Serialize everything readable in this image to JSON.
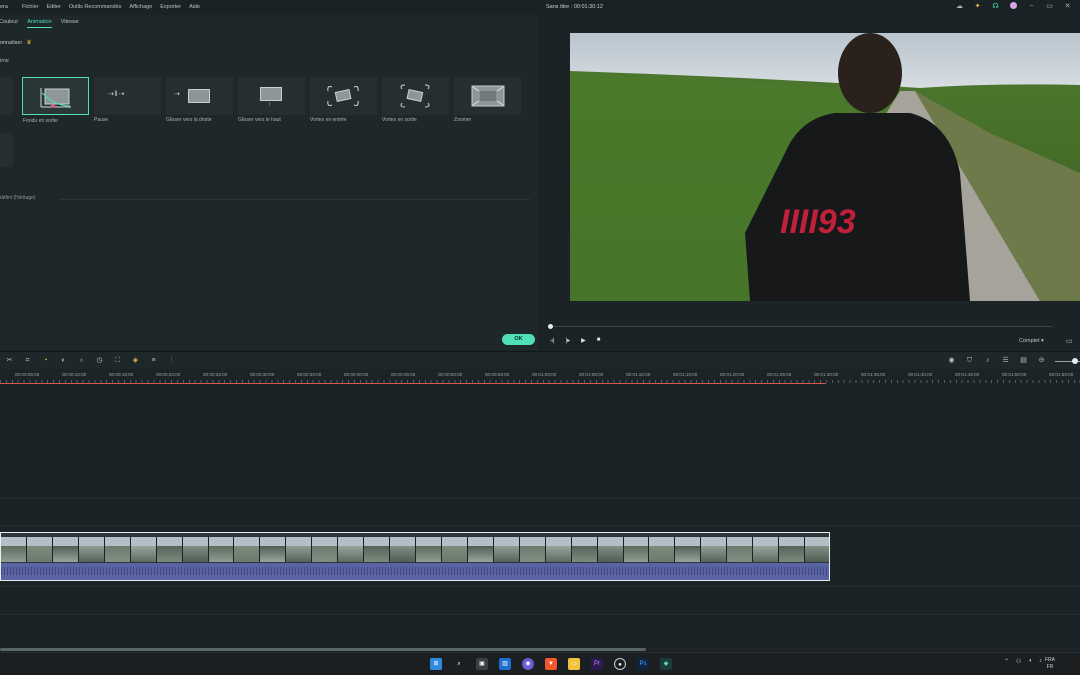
{
  "menu": {
    "app_fragment": "era",
    "items": [
      "Fichier",
      "Editer",
      "Outils Recommandés",
      "Affichage",
      "Exporter",
      "Aide"
    ],
    "project_title": "Sans titre : 00:01:30:12"
  },
  "top_icons": [
    "cloud-icon",
    "bulb-icon",
    "headset-icon",
    "avatar-icon",
    "minimize-icon",
    "maximize-icon",
    "close-icon"
  ],
  "left_panel": {
    "tabs": [
      "Couleur",
      "Animation",
      "Vitesse"
    ],
    "active_tab": "Animation",
    "personalize_label": "onnaliser",
    "preset_label": "ime",
    "animations": [
      {
        "name": "",
        "icon": "partial-icon"
      },
      {
        "name": "Fondu en sortie",
        "icon": "fade-out-icon",
        "selected": true
      },
      {
        "name": "Pause",
        "icon": "pause-icon"
      },
      {
        "name": "Glisser vers la droite",
        "icon": "slide-right-icon"
      },
      {
        "name": "Glisser vers le haut",
        "icon": "slide-up-icon"
      },
      {
        "name": "Vortex en entrée",
        "icon": "vortex-in-icon"
      },
      {
        "name": "Vortex en sortie",
        "icon": "vortex-out-icon"
      },
      {
        "name": "Zoomer",
        "icon": "zoom-icon"
      }
    ],
    "inherit_label": "défini (Héritage)",
    "ok_label": "OK"
  },
  "preview": {
    "quality_label": "Complet",
    "controls": [
      "rewind-icon",
      "step-icon",
      "play-icon",
      "stop-icon"
    ]
  },
  "ruler": {
    "labels": [
      "00:00:05:00",
      "00:00:10:00",
      "00:00:15:00",
      "00:00:20:00",
      "00:00:25:00",
      "00:00:30:00",
      "00:00:35:00",
      "00:00:40:00",
      "00:00:45:00",
      "00:00:50:00",
      "00:00:55:00",
      "00:01:00:00",
      "00:01:05:00",
      "00:01:10:00",
      "00:01:15:00",
      "00:01:20:00",
      "00:01:25:00",
      "00:01:30:00",
      "00:01:35:00",
      "00:01:40:00",
      "00:01:45:00",
      "00:01:50:00",
      "00:01:55:00"
    ]
  },
  "taskbar": {
    "apps": [
      "windows-icon",
      "search-icon",
      "task-view-icon",
      "widgets-icon",
      "chat-icon",
      "brave-icon",
      "explorer-icon",
      "premiere-icon",
      "obs-icon",
      "photoshop-icon",
      "filmora-icon"
    ],
    "lang_line1": "FRA",
    "lang_line2": "FR"
  },
  "colors": {
    "accent": "#4fe0b8",
    "playhead_red": "#d9534f",
    "audio_wave": "#5a63a3"
  }
}
